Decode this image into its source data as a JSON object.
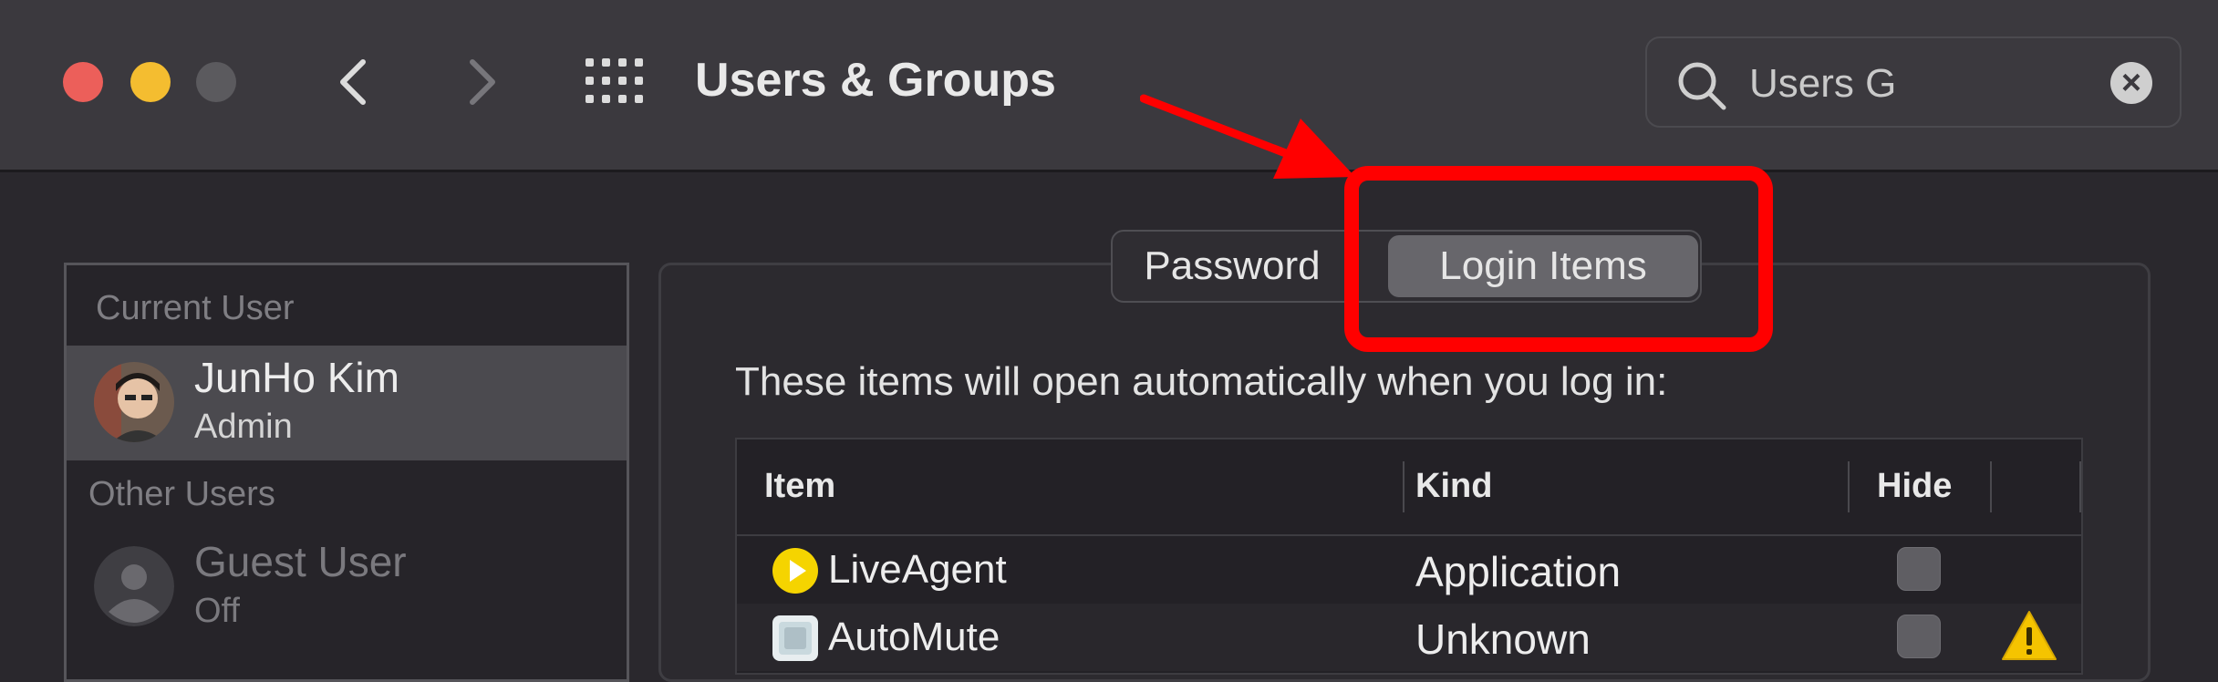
{
  "window": {
    "title": "Users & Groups"
  },
  "search": {
    "value": "Users G",
    "icon": "search-icon"
  },
  "sidebar": {
    "current_user_header": "Current User",
    "current_user": {
      "name": "JunHo Kim",
      "role": "Admin"
    },
    "other_users_header": "Other Users",
    "other_users": [
      {
        "name": "Guest User",
        "status": "Off"
      }
    ]
  },
  "tabs": {
    "items": [
      "Password",
      "Login Items"
    ],
    "selected": "Login Items"
  },
  "login_items": {
    "intro": "These items will open automatically when you log in:",
    "columns": {
      "item": "Item",
      "kind": "Kind",
      "hide": "Hide"
    },
    "rows": [
      {
        "name": "LiveAgent",
        "kind": "Application",
        "hide": false,
        "warning": false
      },
      {
        "name": "AutoMute",
        "kind": "Unknown",
        "hide": false,
        "warning": true
      }
    ]
  },
  "colors": {
    "close": "#ec5f5a",
    "minimize": "#f4bd30",
    "annotation": "#ff0000",
    "warning": "#f5c400"
  }
}
